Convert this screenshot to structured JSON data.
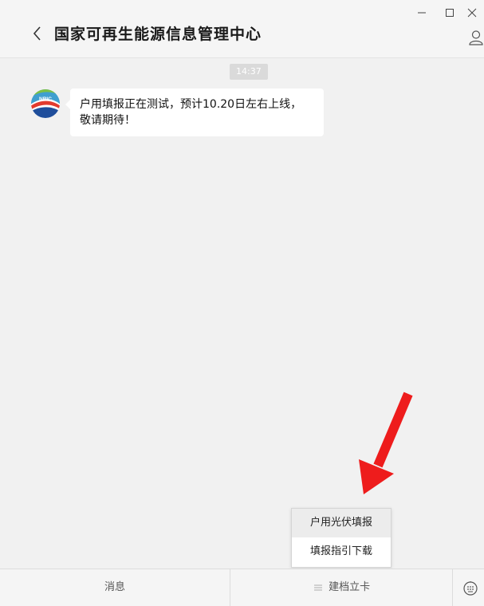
{
  "header": {
    "title": "国家可再生能源信息管理中心"
  },
  "chat": {
    "timestamp": "14:37",
    "avatar_text": "NRIC",
    "message_lines": [
      "户用填报正在测试，预计10.20日左右上线，",
      "敬请期待！"
    ]
  },
  "popup": {
    "items": [
      {
        "label": "户用光伏填报"
      },
      {
        "label": "填报指引下载"
      }
    ]
  },
  "menu": {
    "items": [
      {
        "label": "消息"
      },
      {
        "label": "建档立卡"
      }
    ]
  },
  "colors": {
    "arrow": "#ee1c1c",
    "background": "#f1f1f1",
    "bubble": "#ffffff"
  }
}
